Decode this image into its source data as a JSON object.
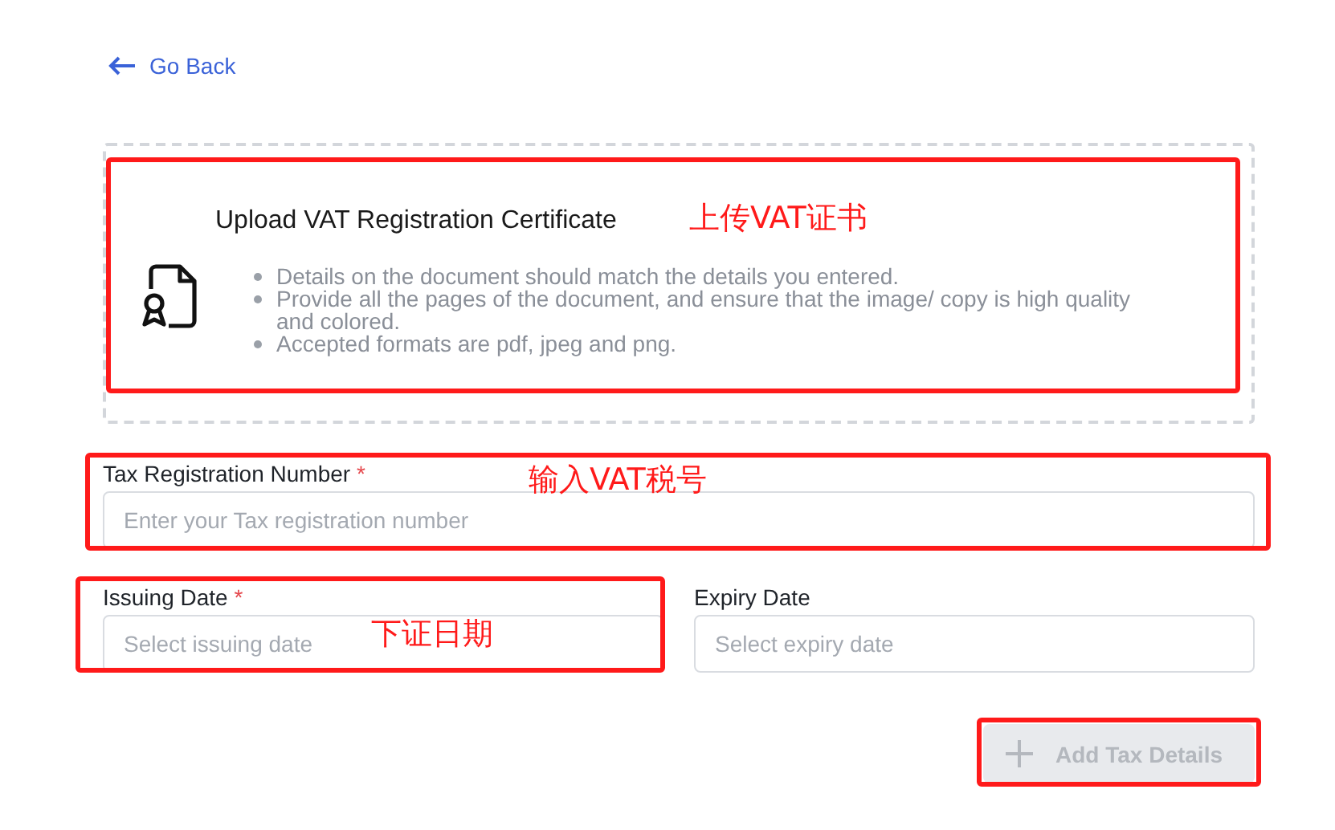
{
  "back_link": {
    "label": "Go Back"
  },
  "upload": {
    "title": "Upload VAT Registration Certificate",
    "highlighted": true,
    "note": "上传VAT证书",
    "requirements": [
      "Details on the document should match the details you entered.",
      "Provide all the pages of the document, and ensure that the image/ copy is high quality and colored.",
      "Accepted formats are pdf, jpeg and png."
    ]
  },
  "fields": [
    {
      "label": "Tax Registration Number",
      "required_mark": "*",
      "placeholder": "Enter your Tax registration number",
      "highlighted": true,
      "note": "输入VAT税号"
    },
    {
      "label": "Issuing Date",
      "required_mark": "*",
      "placeholder": "Select issuing date",
      "highlighted": true,
      "note": "下证日期"
    },
    {
      "label": "Expiry Date",
      "placeholder": "Select expiry date"
    }
  ],
  "button": {
    "label": "Add Tax Details",
    "disabled": true,
    "highlighted": true
  }
}
